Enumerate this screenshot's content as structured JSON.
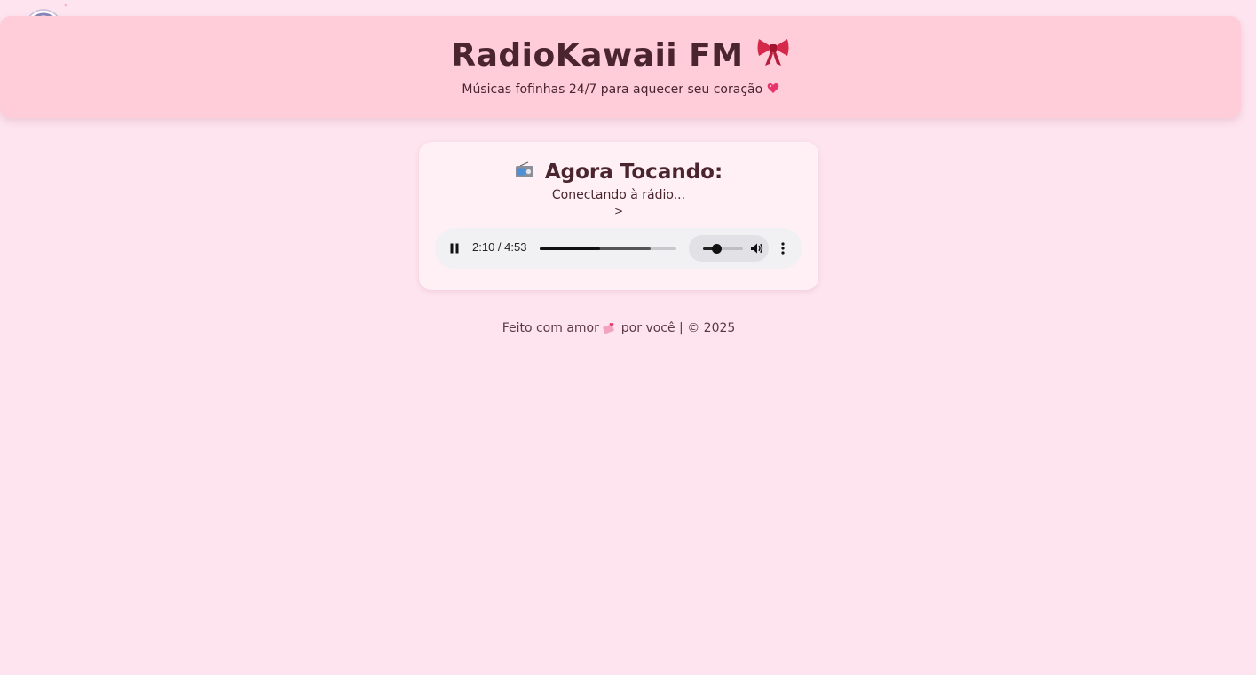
{
  "header": {
    "title": "RadioKawaii FM",
    "tagline": "Músicas fofinhas 24/7 para aquecer seu coração"
  },
  "now_playing": {
    "heading": "Agora Tocando:",
    "status": "Conectando à rádio...",
    "arrow": ">"
  },
  "player": {
    "time": "2:10 / 4:53",
    "progress_fraction": 0.443,
    "buffered_fraction": 0.81,
    "volume_fraction": 0.33
  },
  "footer": {
    "text_before": "Feito com amor",
    "text_after": "por você | © 2025"
  },
  "colors": {
    "background": "#fde4ee",
    "header": "#ffcdd9",
    "card": "#fef0f4",
    "text": "#4a2530",
    "bow": "#d6284a"
  },
  "icons": {
    "mascot": "headphone-mascot-icon",
    "bow": "ribbon-bow-icon",
    "heart": "sparkling-heart-icon",
    "radio": "radio-icon",
    "pause": "pause-icon",
    "volume": "volume-icon",
    "more": "more-vertical-icon",
    "love_letter": "love-letter-icon"
  }
}
